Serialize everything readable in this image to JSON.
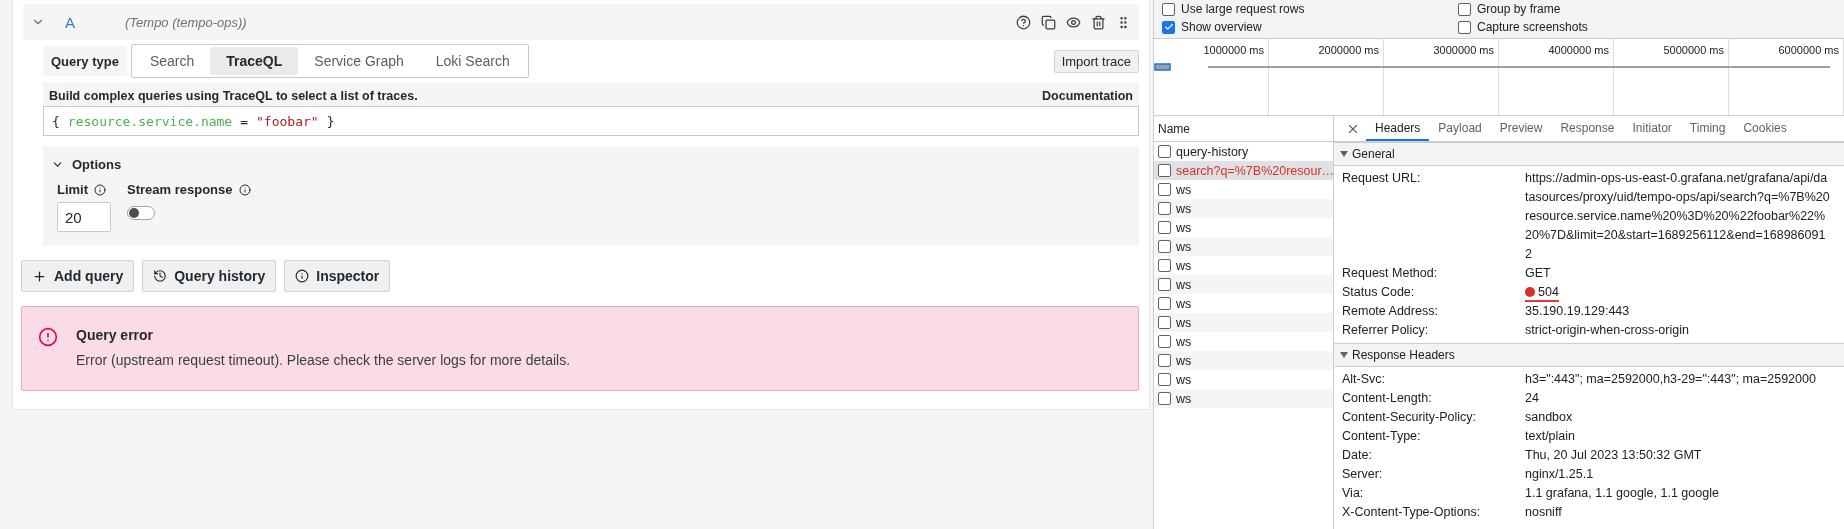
{
  "query_row": {
    "ref_id": "A",
    "datasource": "(Tempo (tempo-ops))",
    "expanded": true
  },
  "query_type": {
    "label": "Query type",
    "options": [
      {
        "label": "Search",
        "selected": false
      },
      {
        "label": "TraceQL",
        "selected": true
      },
      {
        "label": "Service Graph",
        "selected": false
      },
      {
        "label": "Loki Search",
        "selected": false
      }
    ],
    "import_button": "Import trace"
  },
  "editor": {
    "help_text": "Build complex queries using TraceQL to select a list of traces.",
    "documentation_link": "Documentation",
    "tokens": [
      {
        "kind": "punct",
        "text": "{"
      },
      {
        "kind": "attribute",
        "text": "resource.service.name"
      },
      {
        "kind": "operator",
        "text": "="
      },
      {
        "kind": "string",
        "text": "\"foobar\""
      },
      {
        "kind": "punct",
        "text": "}"
      }
    ]
  },
  "options": {
    "title": "Options",
    "expanded": true,
    "limit_label": "Limit",
    "limit_value": "20",
    "stream_label": "Stream response",
    "stream_on": false
  },
  "buttons": [
    {
      "kind": "add",
      "label": "Add query"
    },
    {
      "kind": "history",
      "label": "Query history"
    },
    {
      "kind": "info",
      "label": "Inspector"
    }
  ],
  "error": {
    "title": "Query error",
    "message": "Error (upstream request timeout). Please check the server logs for more details."
  },
  "devtools": {
    "settings": [
      {
        "label": "Use large request rows",
        "checked": false
      },
      {
        "label": "Group by frame",
        "checked": false
      },
      {
        "label": "Show overview",
        "checked": true
      },
      {
        "label": "Capture screenshots",
        "checked": false
      }
    ],
    "overview_ticks": [
      "1000000 ms",
      "2000000 ms",
      "3000000 ms",
      "4000000 ms",
      "5000000 ms",
      "6000000 ms"
    ],
    "name_header": "Name",
    "requests": [
      {
        "name": "query-history",
        "failed": false,
        "selected": false
      },
      {
        "name": "search?q=%7B%20resour…",
        "failed": true,
        "selected": true
      },
      {
        "name": "ws",
        "failed": false,
        "selected": false
      },
      {
        "name": "ws",
        "failed": false,
        "selected": false
      },
      {
        "name": "ws",
        "failed": false,
        "selected": false
      },
      {
        "name": "ws",
        "failed": false,
        "selected": false
      },
      {
        "name": "ws",
        "failed": false,
        "selected": false
      },
      {
        "name": "ws",
        "failed": false,
        "selected": false
      },
      {
        "name": "ws",
        "failed": false,
        "selected": false
      },
      {
        "name": "ws",
        "failed": false,
        "selected": false
      },
      {
        "name": "ws",
        "failed": false,
        "selected": false
      },
      {
        "name": "ws",
        "failed": false,
        "selected": false
      },
      {
        "name": "ws",
        "failed": false,
        "selected": false
      },
      {
        "name": "ws",
        "failed": false,
        "selected": false
      }
    ],
    "tabs": [
      {
        "label": "Headers",
        "selected": true
      },
      {
        "label": "Payload",
        "selected": false
      },
      {
        "label": "Preview",
        "selected": false
      },
      {
        "label": "Response",
        "selected": false
      },
      {
        "label": "Initiator",
        "selected": false
      },
      {
        "label": "Timing",
        "selected": false
      },
      {
        "label": "Cookies",
        "selected": false
      }
    ],
    "sections": [
      {
        "title": "General",
        "expanded": true,
        "rows": [
          {
            "kind": "text",
            "label": "Request URL:",
            "value": "https://admin-ops-us-east-0.grafana.net/grafana/api/datasources/proxy/uid/tempo-ops/api/search?q=%7B%20resource.service.name%20%3D%20%22foobar%22%20%7D&limit=20&start=1689256112&end=1689860912"
          },
          {
            "kind": "text",
            "label": "Request Method:",
            "value": "GET"
          },
          {
            "kind": "status",
            "label": "Status Code:",
            "value": "504",
            "color": "#d93025"
          },
          {
            "kind": "text",
            "label": "Remote Address:",
            "value": "35.190.19.129:443"
          },
          {
            "kind": "text",
            "label": "Referrer Policy:",
            "value": "strict-origin-when-cross-origin"
          }
        ]
      },
      {
        "title": "Response Headers",
        "expanded": true,
        "rows": [
          {
            "kind": "text",
            "label": "Alt-Svc:",
            "value": "h3=\":443\"; ma=2592000,h3-29=\":443\"; ma=2592000"
          },
          {
            "kind": "text",
            "label": "Content-Length:",
            "value": "24"
          },
          {
            "kind": "text",
            "label": "Content-Security-Policy:",
            "value": "sandbox"
          },
          {
            "kind": "text",
            "label": "Content-Type:",
            "value": "text/plain"
          },
          {
            "kind": "text",
            "label": "Date:",
            "value": "Thu, 20 Jul 2023 13:50:32 GMT"
          },
          {
            "kind": "text",
            "label": "Server:",
            "value": "nginx/1.25.1"
          },
          {
            "kind": "text",
            "label": "Via:",
            "value": "1.1 grafana, 1.1 google, 1.1 google"
          },
          {
            "kind": "text",
            "label": "X-Content-Type-Options:",
            "value": "nosniff"
          }
        ]
      }
    ]
  }
}
